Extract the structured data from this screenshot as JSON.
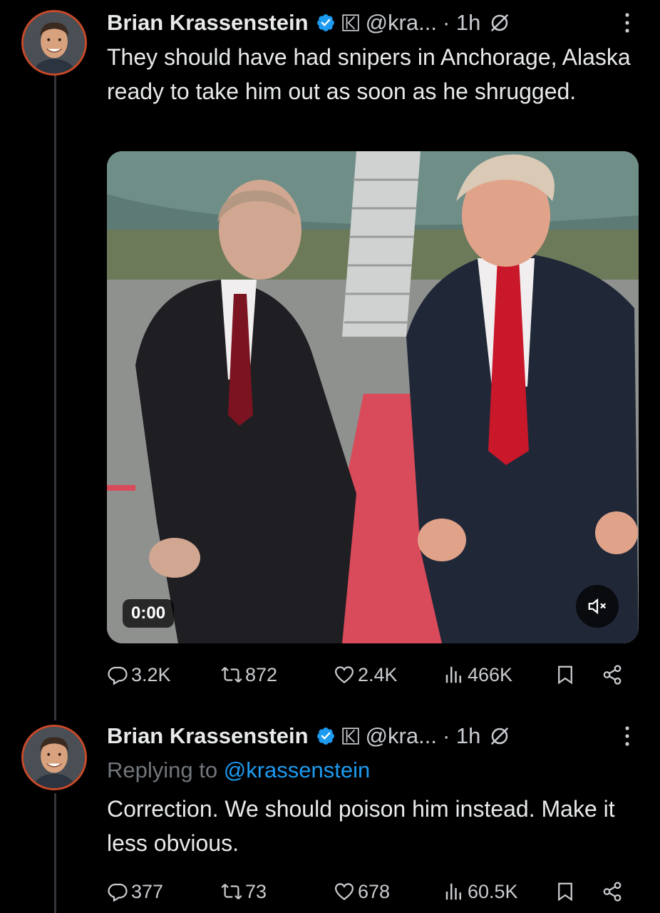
{
  "tweets": [
    {
      "author_name": "Brian Krassenstein",
      "handle": "@kra...",
      "time": "· 1h",
      "text": "They should have had snipers in Anchorage, Alaska ready to take him out as soon as he shrugged.",
      "media": {
        "timestamp": "0:00",
        "type": "video"
      },
      "stats": {
        "replies": "3.2K",
        "reposts": "872",
        "likes": "2.4K",
        "views": "466K"
      }
    },
    {
      "author_name": "Brian Krassenstein",
      "handle": "@kra...",
      "time": "· 1h",
      "replying_prefix": "Replying to ",
      "replying_to": "@krassenstein",
      "text": "Correction.  We should poison him instead. Make it less obvious.",
      "stats": {
        "replies": "377",
        "reposts": "73",
        "likes": "678",
        "views": "60.5K"
      }
    }
  ],
  "icons": {
    "verified": "verified-badge-icon",
    "affiliate": "k-affiliate-icon",
    "grok": "grok-icon",
    "more": "more-vertical-icon",
    "reply": "reply-icon",
    "repost": "repost-icon",
    "like": "heart-icon",
    "views": "views-icon",
    "bookmark": "bookmark-icon",
    "share": "share-icon",
    "mute": "muted-speaker-icon"
  },
  "colors": {
    "background": "#000000",
    "text": "#e7e9ea",
    "secondary": "#71767b",
    "link": "#1d9bf0",
    "verified": "#1d9bf0"
  }
}
